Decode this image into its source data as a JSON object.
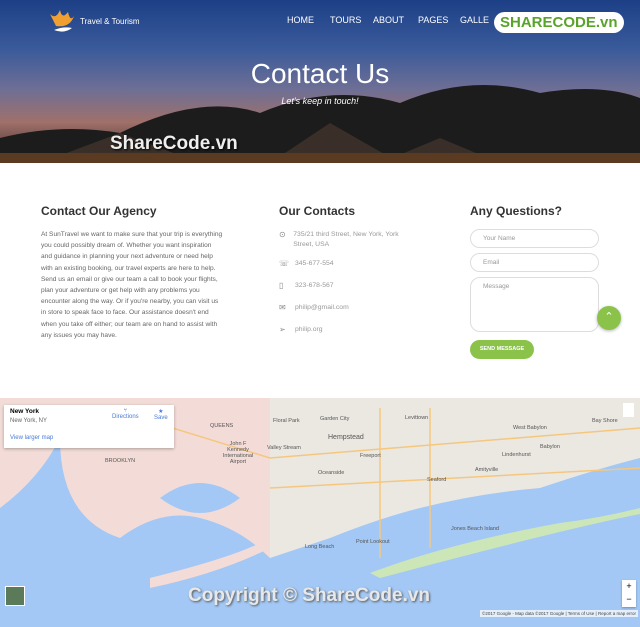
{
  "header": {
    "brand": "Travel & Tourism",
    "nav": [
      "HOME",
      "TOURS",
      "ABOUT",
      "PAGES",
      "GALLE"
    ],
    "title": "Contact Us",
    "subtitle": "Let's keep in touch!",
    "watermark_badge": "SHARECODE.vn",
    "watermark": "ShareCode.vn"
  },
  "agency": {
    "heading": "Contact Our Agency",
    "text": "At SunTravel we want to make sure that your trip is everything you could possibly dream of. Whether you want inspiration and guidance in planning your next adventure or need help with an existing booking, our travel experts are here to help. Send us an email or give our team a call to book your flights, plan your adventure or get help with any problems you encounter along the way. Or if you're nearby, you can visit us in store to speak face to face. Our assistance doesn't end when you take off either; our team are on hand to assist with any issues you may have."
  },
  "contacts": {
    "heading": "Our Contacts",
    "items": [
      {
        "icon": "location-icon",
        "text": "735/21 third Street, New York, York Street, USA"
      },
      {
        "icon": "phone-icon",
        "text": "345-677-554"
      },
      {
        "icon": "mobile-icon",
        "text": "323-678-567"
      },
      {
        "icon": "mail-icon",
        "text": "philip@gmail.com"
      },
      {
        "icon": "send-icon",
        "text": "philip.org"
      }
    ]
  },
  "form": {
    "heading": "Any Questions?",
    "name_placeholder": "Your Name",
    "email_placeholder": "Email",
    "message_placeholder": "Message",
    "submit": "SEND MESSAGE"
  },
  "map": {
    "place": "New York",
    "place_sub": "New York, NY",
    "directions": "Directions",
    "save": "Save",
    "larger": "View larger map",
    "labels": [
      "QUEENS",
      "BROOKLYN",
      "Hempstead",
      "Levittown",
      "Garden City",
      "Floral Park",
      "Valley Stream",
      "Freeport",
      "Oceanside",
      "Long Beach",
      "Point Lookout",
      "Jones Beach Island",
      "West Babylon",
      "Babylon",
      "Lindenhurst",
      "Amityville",
      "Seaford",
      "Bay Shore",
      "John F Kennedy International Airport"
    ],
    "attribution": "©2017 Google - Map data ©2017 Google | Terms of Use | Report a map error",
    "watermark": "Copyright © ShareCode.vn"
  },
  "colors": {
    "accent": "#8bc34a"
  }
}
